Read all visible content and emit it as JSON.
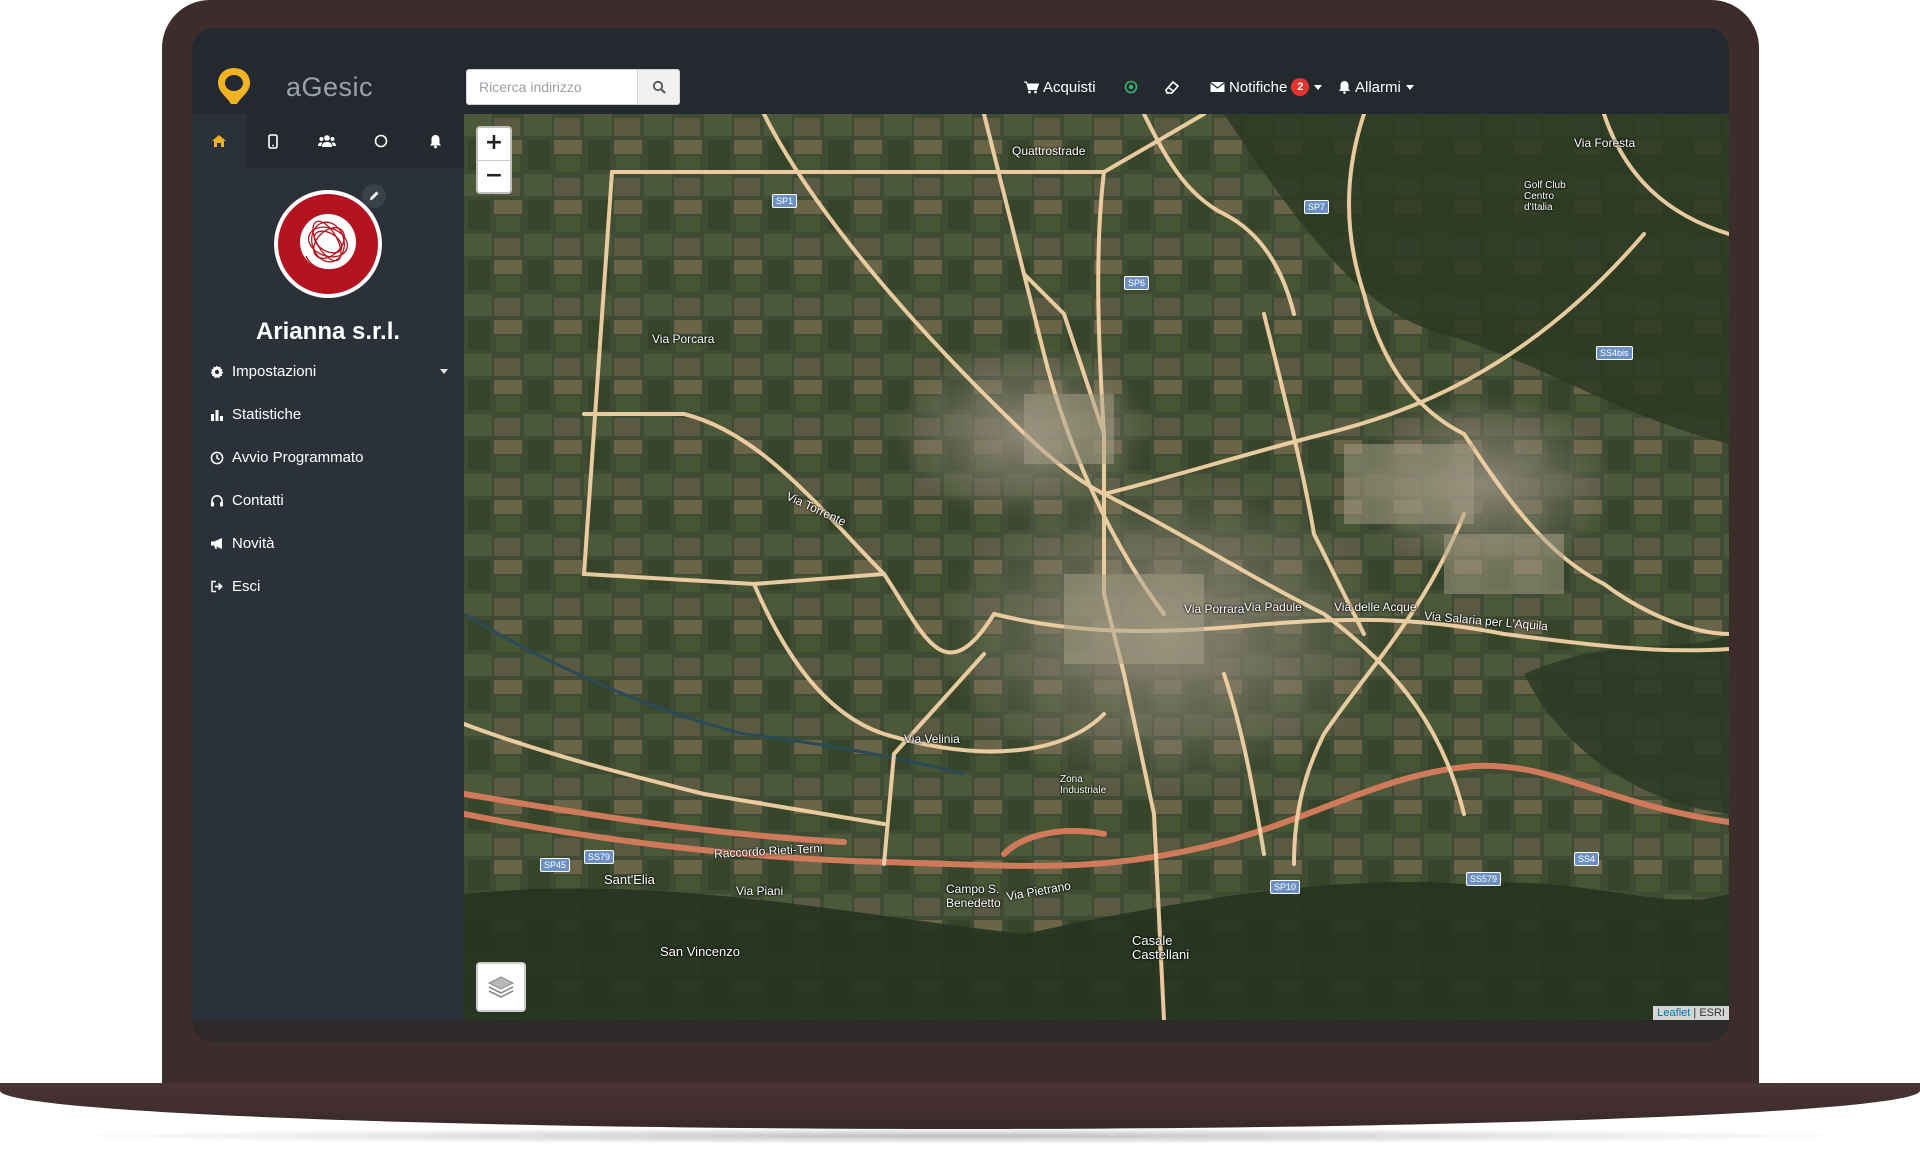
{
  "app": {
    "name": "aGesic",
    "accent_color": "#f0b323",
    "logo_icon": "map-pin-logo"
  },
  "search": {
    "placeholder": "Ricerca indirizzo",
    "button_icon": "search-icon"
  },
  "navbar": {
    "purchases_label": "Acquisti",
    "notifications_label": "Notifiche",
    "notifications_count": "2",
    "alarms_label": "Allarmi",
    "status_icon": "target-icon",
    "eraser_icon": "eraser-icon"
  },
  "sidebar": {
    "tabs": [
      {
        "icon": "home-icon",
        "active": true
      },
      {
        "icon": "mobile-icon",
        "active": false
      },
      {
        "icon": "users-icon",
        "active": false
      },
      {
        "icon": "circle-icon",
        "active": false
      },
      {
        "icon": "bell-icon",
        "active": false
      }
    ],
    "company_name": "Arianna s.r.l.",
    "menu": [
      {
        "label": "Impostazioni",
        "icon": "gear-icon",
        "has_dropdown": true
      },
      {
        "label": "Statistiche",
        "icon": "bar-chart-icon"
      },
      {
        "label": "Avvio Programmato",
        "icon": "clock-icon"
      },
      {
        "label": "Contatti",
        "icon": "headset-icon"
      },
      {
        "label": "Novità",
        "icon": "megaphone-icon"
      },
      {
        "label": "Esci",
        "icon": "sign-out-icon"
      }
    ]
  },
  "map": {
    "zoom_in": "+",
    "zoom_out": "−",
    "attribution_leaflet": "Leaflet",
    "attribution_sep": " | ",
    "attribution_esri": "ESRI",
    "labels": {
      "quattrostrade": "Quattrostrade",
      "via_foresta": "Via Foresta",
      "golf": "Golf Club Centro d'Italia",
      "via_porcara": "Via Porcara",
      "via_torrente": "Via Torrente",
      "via_velinia": "Via Velinia",
      "via_porrara": "Via Porrara",
      "via_padule": "Via Padule",
      "viale_acque": "Via delle Acque",
      "via_salaria": "Via Salaria per L'Aquila",
      "raccordo": "Raccordo Rieti-Terni",
      "santelia": "Sant'Elia",
      "via_piani": "Via Piani",
      "san_vincenzo": "San Vincenzo",
      "casale": "Casale Castellani",
      "campo": "Campo S. Benedetto",
      "zona": "Zona Industriale",
      "via_pietrano": "Via Pietrano"
    },
    "shields": [
      "SP1",
      "SP6",
      "SP7",
      "SS4bis",
      "SP45",
      "SS79",
      "SP10",
      "SS579",
      "SS4"
    ]
  }
}
